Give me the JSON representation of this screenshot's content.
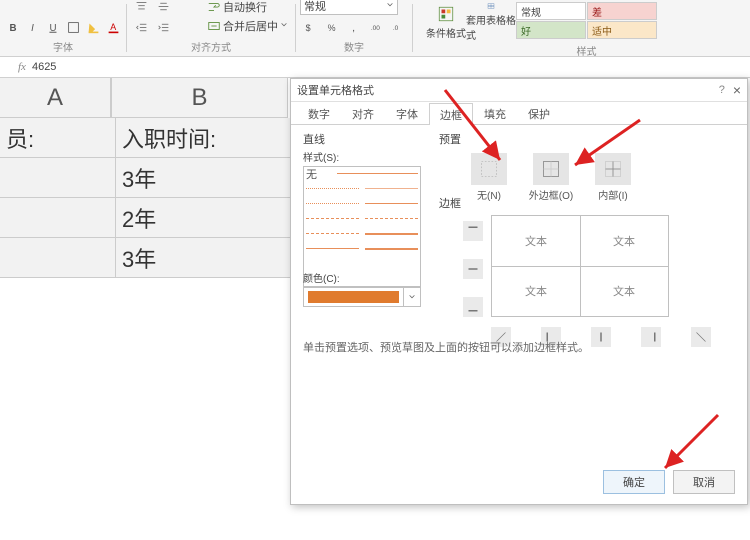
{
  "ribbon": {
    "font_group_label": "字体",
    "align_group_label": "对齐方式",
    "number_group_label": "数字",
    "styles_group_label": "样式",
    "wrap_label": "自动换行",
    "merge_label": "合并后居中",
    "number_format": "常规",
    "cond_fmt_label": "条件格式",
    "table_fmt_label": "套用表格格式",
    "swatches": {
      "normal": "常规",
      "bad": "差",
      "good": "好",
      "neutral": "适中"
    }
  },
  "formula_value": "4625",
  "columns": {
    "a": "A",
    "b": "B"
  },
  "rows": [
    {
      "a": "员:",
      "b": "入职时间:"
    },
    {
      "a": "",
      "b": "3年"
    },
    {
      "a": "",
      "b": "2年"
    },
    {
      "a": "",
      "b": "3年"
    }
  ],
  "dialog": {
    "title": "设置单元格格式",
    "tabs": {
      "number": "数字",
      "align": "对齐",
      "font": "字体",
      "border": "边框",
      "fill": "填充",
      "protect": "保护"
    },
    "line_section": "直线",
    "preset_section": "预置",
    "style_label": "样式(S):",
    "style_none": "无",
    "color_label": "颜色(C):",
    "presets": {
      "none": "无(N)",
      "outline": "外边框(O)",
      "inside": "内部(I)"
    },
    "border_section": "边框",
    "preview_text": "文本",
    "hint": "单击预置选项、预览草图及上面的按钮可以添加边框样式。",
    "ok": "确定",
    "cancel": "取消"
  }
}
